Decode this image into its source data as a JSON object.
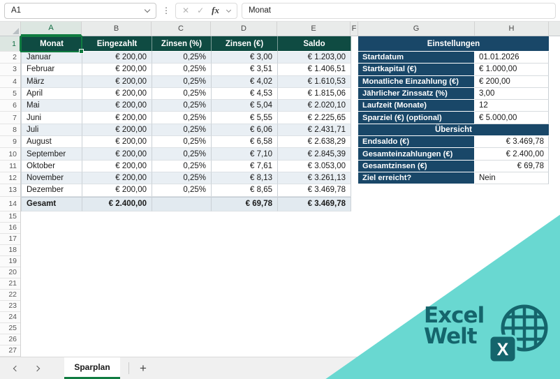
{
  "formula_bar": {
    "cell_ref": "A1",
    "formula_value": "Monat",
    "fx_label": "fx"
  },
  "grid": {
    "column_letters": [
      "A",
      "B",
      "C",
      "D",
      "E",
      "F",
      "G",
      "H"
    ],
    "visible_row_count": 27,
    "selected_cell": "A1"
  },
  "table": {
    "headers": [
      "Monat",
      "Eingezahlt",
      "Zinsen (%)",
      "Zinsen (€)",
      "Saldo"
    ],
    "rows": [
      [
        "Januar",
        "€ 200,00",
        "0,25%",
        "€ 3,00",
        "€ 1.203,00"
      ],
      [
        "Februar",
        "€ 200,00",
        "0,25%",
        "€ 3,51",
        "€ 1.406,51"
      ],
      [
        "März",
        "€ 200,00",
        "0,25%",
        "€ 4,02",
        "€ 1.610,53"
      ],
      [
        "April",
        "€ 200,00",
        "0,25%",
        "€ 4,53",
        "€ 1.815,06"
      ],
      [
        "Mai",
        "€ 200,00",
        "0,25%",
        "€ 5,04",
        "€ 2.020,10"
      ],
      [
        "Juni",
        "€ 200,00",
        "0,25%",
        "€ 5,55",
        "€ 2.225,65"
      ],
      [
        "Juli",
        "€ 200,00",
        "0,25%",
        "€ 6,06",
        "€ 2.431,71"
      ],
      [
        "August",
        "€ 200,00",
        "0,25%",
        "€ 6,58",
        "€ 2.638,29"
      ],
      [
        "September",
        "€ 200,00",
        "0,25%",
        "€ 7,10",
        "€ 2.845,39"
      ],
      [
        "Oktober",
        "€ 200,00",
        "0,25%",
        "€ 7,61",
        "€ 3.053,00"
      ],
      [
        "November",
        "€ 200,00",
        "0,25%",
        "€ 8,13",
        "€ 3.261,13"
      ],
      [
        "Dezember",
        "€ 200,00",
        "0,25%",
        "€ 8,65",
        "€ 3.469,78"
      ]
    ],
    "total_row": [
      "Gesamt",
      "€ 2.400,00",
      "",
      "€ 69,78",
      "€ 3.469,78"
    ]
  },
  "settings": {
    "title": "Einstellungen",
    "rows": [
      {
        "label": "Startdatum",
        "value": "01.01.2026",
        "align": "left"
      },
      {
        "label": "Startkapital (€)",
        "value": "€ 1.000,00",
        "align": "left"
      },
      {
        "label": "Monatliche Einzahlung (€)",
        "value": "€ 200,00",
        "align": "left"
      },
      {
        "label": "Jährlicher Zinssatz (%)",
        "value": "3,00",
        "align": "left"
      },
      {
        "label": "Laufzeit (Monate)",
        "value": "12",
        "align": "left"
      },
      {
        "label": "Sparziel (€) (optional)",
        "value": "€ 5.000,00",
        "align": "left"
      }
    ]
  },
  "overview": {
    "title": "Übersicht",
    "rows": [
      {
        "label": "Endsaldo (€)",
        "value": "€ 3.469,78",
        "align": "right"
      },
      {
        "label": "Gesamteinzahlungen (€)",
        "value": "€ 2.400,00",
        "align": "right"
      },
      {
        "label": "Gesamtzinsen (€)",
        "value": "€ 69,78",
        "align": "right"
      },
      {
        "label": "Ziel erreicht?",
        "value": "Nein",
        "align": "left"
      }
    ]
  },
  "sheet_tabs": {
    "tabs": [
      {
        "label": "Sparplan",
        "active": true
      }
    ],
    "add_label": "+"
  },
  "logo": {
    "line1": "Excel",
    "line2": "Welt",
    "badge_letter": "X"
  },
  "colors": {
    "header_green": "#0F4B42",
    "panel_navy": "#194768",
    "selection_green": "#107C41",
    "band_blue": "#E9EFF4",
    "triangle_teal": "#69D8D1",
    "logo_teal": "#15656C"
  }
}
